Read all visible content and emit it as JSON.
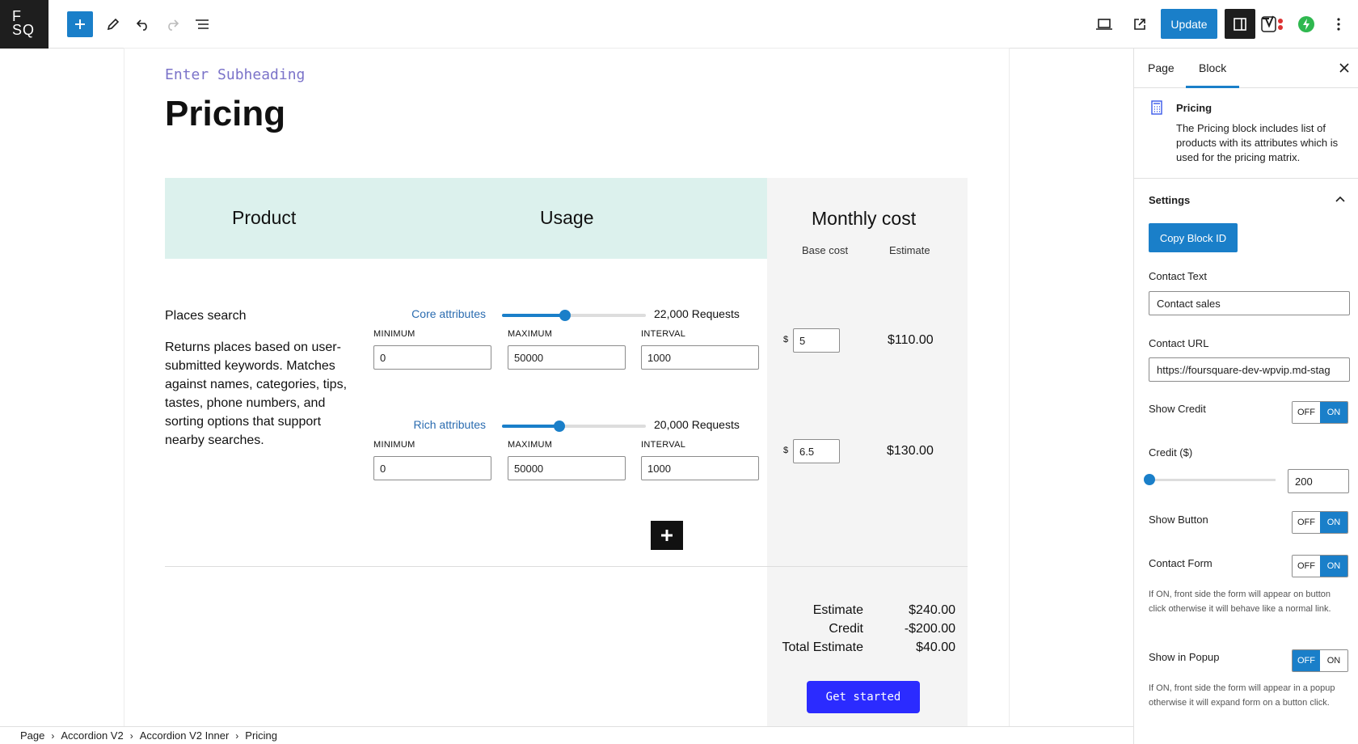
{
  "logo": {
    "line1": "F",
    "line2": "SQ"
  },
  "toolbar": {
    "update_label": "Update"
  },
  "editor": {
    "subheading": "Enter Subheading",
    "title": "Pricing",
    "table": {
      "headers": {
        "product": "Product",
        "usage": "Usage",
        "monthly_cost": "Monthly cost",
        "base_cost": "Base cost",
        "estimate": "Estimate"
      },
      "product": {
        "name": "Places search",
        "description": "Returns places based on user-submitted keywords. Matches against names, categories, tips, tastes, phone numbers, and sorting options that support nearby searches."
      },
      "attributes": [
        {
          "label": "Core attributes",
          "requests": "22,000 Requests",
          "slider_fraction": 0.44,
          "min_label": "MINIMUM",
          "max_label": "MAXIMUM",
          "interval_label": "INTERVAL",
          "min": "0",
          "max": "50000",
          "interval": "1000",
          "currency": "$",
          "base_cost": "5",
          "estimate": "$110.00"
        },
        {
          "label": "Rich attributes",
          "requests": "20,000 Requests",
          "slider_fraction": 0.4,
          "min_label": "MINIMUM",
          "max_label": "MAXIMUM",
          "interval_label": "INTERVAL",
          "min": "0",
          "max": "50000",
          "interval": "1000",
          "currency": "$",
          "base_cost": "6.5",
          "estimate": "$130.00"
        }
      ],
      "summary": {
        "estimate_label": "Estimate",
        "estimate_value": "$240.00",
        "credit_label": "Credit",
        "credit_value": "-$200.00",
        "total_label": "Total Estimate",
        "total_value": "$40.00"
      },
      "cta": "Get started"
    }
  },
  "breadcrumbs": [
    "Page",
    "Accordion V2",
    "Accordion V2 Inner",
    "Pricing"
  ],
  "sidebar": {
    "tabs": {
      "page": "Page",
      "block": "Block"
    },
    "block": {
      "title": "Pricing",
      "description": "The Pricing block includes list of products with its attributes which is used for the pricing matrix."
    },
    "settings": {
      "title": "Settings",
      "copy_block_id": "Copy Block ID",
      "contact_text_label": "Contact Text",
      "contact_text_value": "Contact sales",
      "contact_url_label": "Contact URL",
      "contact_url_value": "https://foursquare-dev-wpvip.md-stag",
      "show_credit_label": "Show Credit",
      "credit_label": "Credit ($)",
      "credit_value": "200",
      "show_button_label": "Show Button",
      "contact_form_label": "Contact Form",
      "contact_form_help": "If ON, front side the form will appear on button click otherwise it will behave like a normal link.",
      "show_popup_label": "Show in Popup",
      "show_popup_help": "If ON, front side the form will appear in a popup otherwise it will expand form on a button click.",
      "toggle_off": "OFF",
      "toggle_on": "ON"
    }
  },
  "colors": {
    "accent": "#1a7fc9",
    "cta": "#2b2bff",
    "header_bg": "#dcf1ed"
  }
}
